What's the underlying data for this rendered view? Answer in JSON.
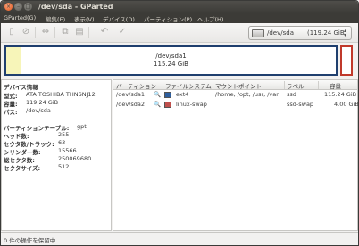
{
  "window": {
    "title": "/dev/sda - GParted"
  },
  "window_buttons": {
    "close": "×",
    "minimize": "–",
    "maximize": "□"
  },
  "menubar": [
    "GParted(G)",
    "編集(E)",
    "表示(V)",
    "デバイス(D)",
    "パーティション(P)",
    "ヘルプ(H)"
  ],
  "toolbar": {
    "icons": [
      "new-partition-icon",
      "delete-icon",
      "resize-move-icon",
      "copy-icon",
      "paste-icon",
      "undo-icon",
      "apply-icon"
    ],
    "glyphs": [
      "▯",
      "⊘",
      "⇔",
      "⧉",
      "▤",
      "↶",
      "✓"
    ],
    "device_name": "/dev/sda",
    "device_size": "(119.24 GiB)",
    "combo_arrows": "▲▼"
  },
  "diskmap": {
    "partition1_name": "/dev/sda1",
    "partition1_size": "115.24 GiB",
    "partition1_color": "#1f3f6e",
    "partition2_color": "#c0392b",
    "used_color": "#f7f5b9"
  },
  "device_info": {
    "heading": "デバイス情報",
    "rows": [
      {
        "label": "型式:",
        "value": "ATA TOSHIBA THNSNJ12"
      },
      {
        "label": "容量:",
        "value": "119.24 GiB"
      },
      {
        "label": "パス:",
        "value": "/dev/sda"
      }
    ],
    "rows2": [
      {
        "label": "パーティションテーブル:",
        "value": "gpt"
      },
      {
        "label": "ヘッド数:",
        "value": "255"
      },
      {
        "label": "セクタ数/トラック:",
        "value": "63"
      },
      {
        "label": "シリンダー数:",
        "value": "15566"
      },
      {
        "label": "総セクタ数:",
        "value": "250069680"
      },
      {
        "label": "セクタサイズ:",
        "value": "512"
      }
    ]
  },
  "partition_table": {
    "columns": [
      "パーティション",
      "ファイルシステム",
      "マウントポイント",
      "ラベル",
      "容量"
    ],
    "rows": [
      {
        "partition": "/dev/sda1",
        "fs": "ext4",
        "fs_color": "#2f5f9e",
        "mount": "/home, /opt, /usr, /var",
        "label": "ssd",
        "size": "115.24 GiB"
      },
      {
        "partition": "/dev/sda2",
        "fs": "linux-swap",
        "fs_color": "#c0504d",
        "mount": "",
        "label": "ssd-swap",
        "size": "4.00 GiB"
      }
    ]
  },
  "status": {
    "text": "0 件の操作を保留中"
  }
}
